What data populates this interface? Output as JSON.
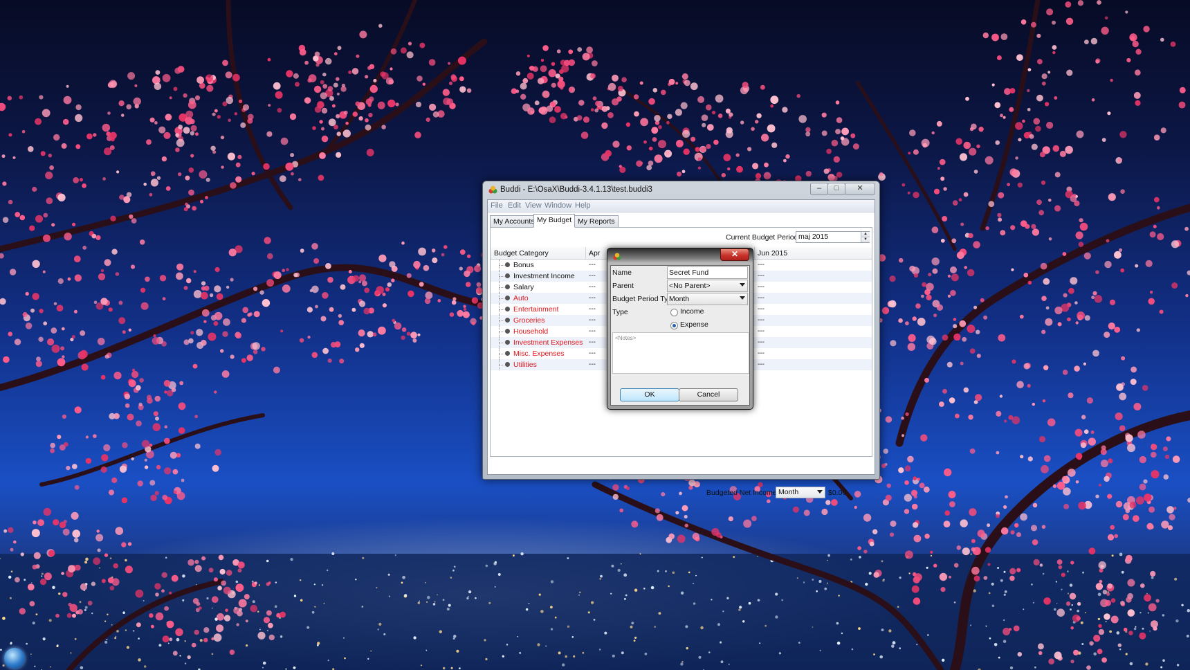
{
  "desktop": {
    "wallpaper_icon": "cherry-blossom-night-city",
    "start_icon": "windows-start-orb"
  },
  "window": {
    "title": "Buddi - E:\\OsaX\\Buddi-3.4.1.13\\test.buddi3",
    "app_icon": "buddi-app-icon",
    "controls": {
      "minimize": "–",
      "maximize": "□",
      "close": "✕"
    }
  },
  "menu": [
    "File",
    "Edit",
    "View",
    "Window",
    "Help"
  ],
  "tabs": [
    "My Accounts",
    "My Budget",
    "My Reports"
  ],
  "active_tab": "My Budget",
  "budget": {
    "period_label": "Current Budget Period",
    "period_value": "maj 2015",
    "columns": [
      "Budget Category",
      "Apr",
      "Jun 2015"
    ],
    "rows": [
      {
        "name": "Bonus",
        "type": "income",
        "apr": "---",
        "jun": "---"
      },
      {
        "name": "Investment Income",
        "type": "income",
        "apr": "---",
        "jun": "---"
      },
      {
        "name": "Salary",
        "type": "income",
        "apr": "---",
        "jun": "---"
      },
      {
        "name": "Auto",
        "type": "expense",
        "apr": "---",
        "jun": "---"
      },
      {
        "name": "Entertainment",
        "type": "expense",
        "apr": "---",
        "jun": "---"
      },
      {
        "name": "Groceries",
        "type": "expense",
        "apr": "---",
        "jun": "---"
      },
      {
        "name": "Household",
        "type": "expense",
        "apr": "---",
        "jun": "---"
      },
      {
        "name": "Investment Expenses",
        "type": "expense",
        "apr": "---",
        "jun": "---"
      },
      {
        "name": "Misc. Expenses",
        "type": "expense",
        "apr": "---",
        "jun": "---"
      },
      {
        "name": "Utilities",
        "type": "expense",
        "apr": "---",
        "jun": "---"
      }
    ],
    "net_income_label": "Budgeted Net Income /",
    "net_income_period": "Month",
    "net_income_value": "$0.00",
    "expense_color": "#e3141c"
  },
  "dialog": {
    "close": "✕",
    "fields": {
      "name_label": "Name",
      "name_value": "Secret Fund",
      "parent_label": "Parent",
      "parent_value": "<No Parent>",
      "period_type_label": "Budget Period Type",
      "period_type_value": "Month",
      "type_label": "Type",
      "income_label": "Income",
      "expense_label": "Expense",
      "selected_type": "Expense"
    },
    "notes_placeholder": "<Notes>",
    "ok_label": "OK",
    "cancel_label": "Cancel"
  }
}
